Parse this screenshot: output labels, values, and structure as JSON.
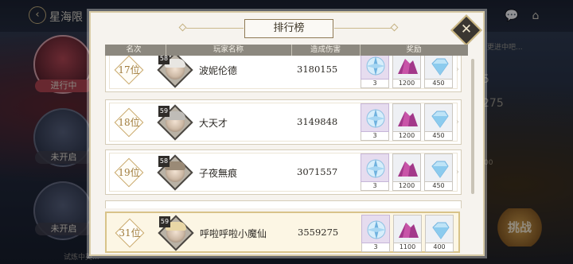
{
  "background": {
    "title": "星海限",
    "sideEntries": [
      {
        "label": "进行中",
        "active": true
      },
      {
        "label": "未开启",
        "active": false
      },
      {
        "label": "未开启",
        "active": false
      }
    ],
    "rightTexts": [
      "5",
      "275",
      "00",
      "更进中吧..."
    ],
    "challenge": "挑战",
    "hint": "试炼中英..."
  },
  "modal": {
    "title": "排行榜",
    "headers": [
      "名次",
      "玩家名称",
      "造成伤害",
      "奖励"
    ]
  },
  "rows": [
    {
      "rank": "17位",
      "level": "58",
      "name": "波妮伦德",
      "damage": "3180155",
      "hair": "#e8e6e2",
      "rewards": [
        {
          "icon": "compass-crystal-icon",
          "qty": "3"
        },
        {
          "icon": "purple-ore-icon",
          "qty": "1200"
        },
        {
          "icon": "blue-gem-icon",
          "qty": "450"
        }
      ]
    },
    {
      "rank": "18位",
      "level": "59",
      "name": "大天才",
      "damage": "3149848",
      "hair": "#bfbcb7",
      "rewards": [
        {
          "icon": "compass-crystal-icon",
          "qty": "3"
        },
        {
          "icon": "purple-ore-icon",
          "qty": "1200"
        },
        {
          "icon": "blue-gem-icon",
          "qty": "450"
        }
      ]
    },
    {
      "rank": "19位",
      "level": "58",
      "name": "子夜無痕",
      "damage": "3071557",
      "hair": "#9a8a76",
      "rewards": [
        {
          "icon": "compass-crystal-icon",
          "qty": "3"
        },
        {
          "icon": "purple-ore-icon",
          "qty": "1200"
        },
        {
          "icon": "blue-gem-icon",
          "qty": "450"
        }
      ]
    }
  ],
  "selfRow": {
    "rank": "31位",
    "level": "59",
    "name": "呼啦呼啦小魔仙",
    "damage": "3559275",
    "hair": "#e9d7a6",
    "rewards": [
      {
        "icon": "compass-crystal-icon",
        "qty": "3"
      },
      {
        "icon": "purple-ore-icon",
        "qty": "1100"
      },
      {
        "icon": "blue-gem-icon",
        "qty": "400"
      }
    ]
  }
}
